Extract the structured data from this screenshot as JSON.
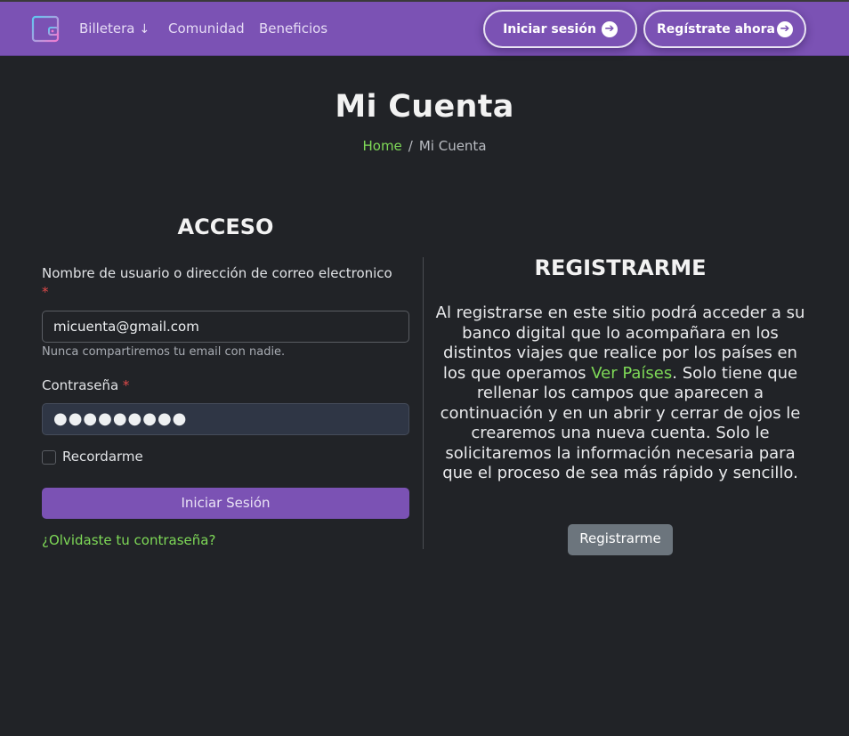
{
  "nav": {
    "links": [
      {
        "label": "Billetera",
        "arrow": "↓"
      },
      {
        "label": "Comunidad"
      },
      {
        "label": "Beneficios"
      }
    ],
    "login_button": "Iniciar sesión",
    "register_button": "Regístrate ahora",
    "arrow_glyph": "➔",
    "brand_color": "#7b52b4",
    "logo_icon": "wallet-icon"
  },
  "page": {
    "title": "Mi Cuenta",
    "breadcrumb": {
      "home": "Home",
      "separator": "/",
      "current": "Mi Cuenta"
    }
  },
  "login": {
    "title": "ACCESO",
    "username_label": "Nombre de usuario o dirección de correo electronico",
    "required_mark": "*",
    "username_value": "micuenta@gmail.com",
    "username_help": "Nunca compartiremos tu email con nadie.",
    "password_label": "Contraseña",
    "password_value": "●●●●●●●●●",
    "remember_label": "Recordarme",
    "submit_label": "Iniciar Sesión",
    "forgot_link": "¿Olvidaste tu contraseña?"
  },
  "register": {
    "title": "REGISTRARME",
    "text_before": "Al registrarse en este sitio podrá acceder a su banco digital que lo acompañara en los distintos viajes que realice por los países en los que operamos ",
    "link": "Ver Países",
    "text_after": ". Solo tiene que rellenar los campos que aparecen a continuación y en un abrir y cerrar de ojos le crearemos una nueva cuenta. Solo le solicitaremos la información necesaria para que el proceso de sea más rápido y sencillo.",
    "button": "Registrarme"
  },
  "colors": {
    "accent_green": "#7ed957",
    "background": "#212327",
    "required_red": "#e04a4a"
  }
}
